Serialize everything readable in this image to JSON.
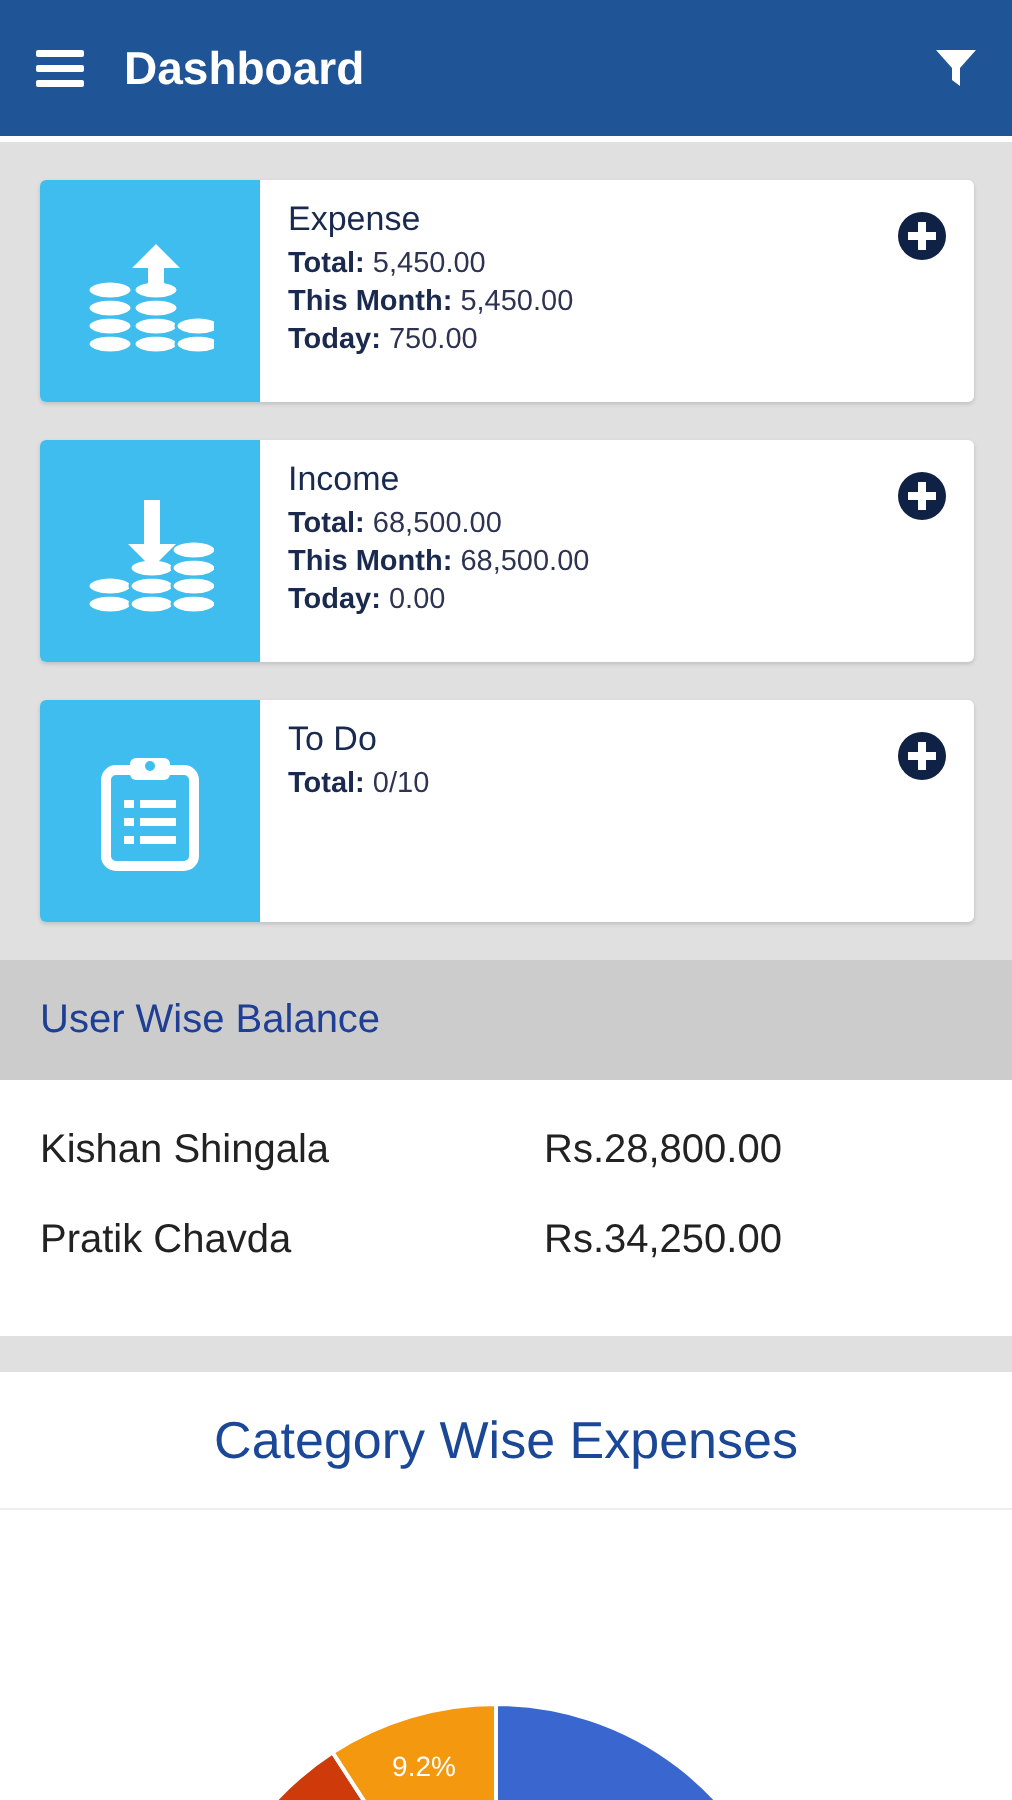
{
  "app_bar": {
    "title": "Dashboard"
  },
  "cards": [
    {
      "kind": "expense",
      "title": "Expense",
      "lines": [
        {
          "label": "Total:",
          "value": "5,450.00"
        },
        {
          "label": "This Month:",
          "value": "5,450.00"
        },
        {
          "label": "Today:",
          "value": "750.00"
        }
      ]
    },
    {
      "kind": "income",
      "title": "Income",
      "lines": [
        {
          "label": "Total:",
          "value": "68,500.00"
        },
        {
          "label": "This Month:",
          "value": "68,500.00"
        },
        {
          "label": "Today:",
          "value": "0.00"
        }
      ]
    },
    {
      "kind": "todo",
      "title": "To Do",
      "lines": [
        {
          "label": "Total:",
          "value": "0/10"
        }
      ]
    }
  ],
  "user_balance": {
    "title": "User Wise Balance",
    "rows": [
      {
        "name": "Kishan Shingala",
        "amount": "Rs.28,800.00"
      },
      {
        "name": "Pratik Chavda",
        "amount": "Rs.34,250.00"
      }
    ]
  },
  "category_expenses": {
    "title": "Category Wise Expenses",
    "slice_labels": [
      "9.2%"
    ]
  }
}
